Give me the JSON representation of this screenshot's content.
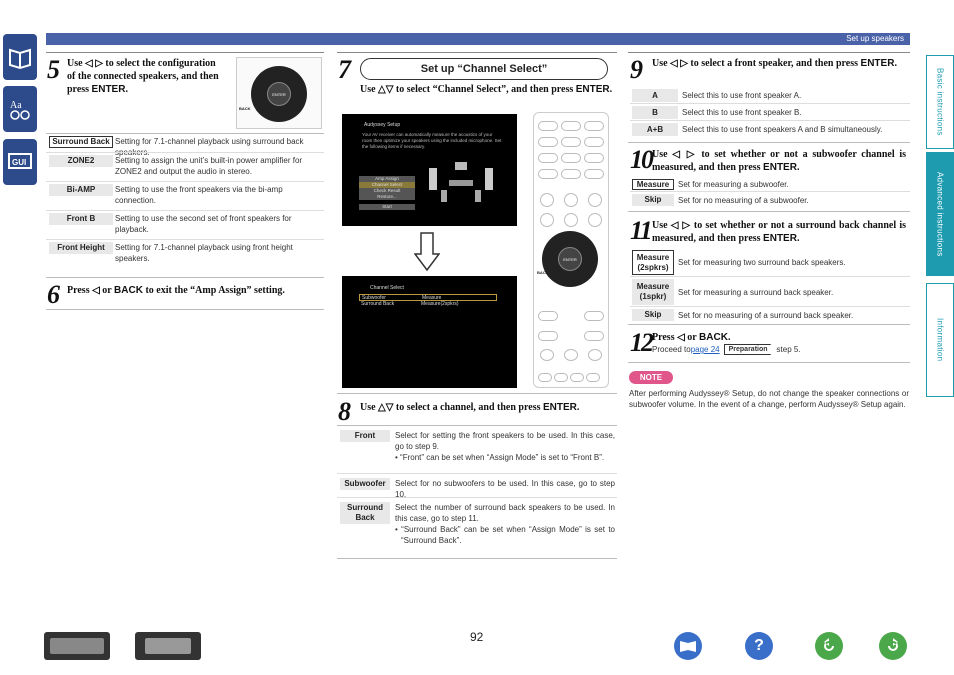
{
  "header": {
    "section": "Set up speakers"
  },
  "sidebar_tabs": [
    "Basic instructions",
    "Advanced instructions",
    "Information"
  ],
  "step5": {
    "num": "5",
    "text_pre": "Use ◁ ▷ to select the configuration of the connected speakers, and then press ",
    "enter": "ENTER",
    "text_post": ".",
    "rows": [
      {
        "label": "Surround Back",
        "desc": "Setting for 7.1-channel playback using surround back speakers."
      },
      {
        "label": "ZONE2",
        "desc": "Setting to assign the unit’s built-in power amplifier for ZONE2 and output the audio in stereo."
      },
      {
        "label": "Bi-AMP",
        "desc": "Setting to use the front speakers via the bi-amp connection."
      },
      {
        "label": "Front B",
        "desc": "Setting to use the second set of front speakers for playback."
      },
      {
        "label": "Front Height",
        "desc": "Setting for 7.1-channel playback using front height speakers."
      }
    ]
  },
  "step6": {
    "num": "6",
    "text_pre": "Press ◁ or ",
    "back": "BACK",
    "text_post": " to exit the “Amp Assign” setting."
  },
  "step7": {
    "num": "7",
    "title": "Set up “Channel Select”",
    "text_pre": "Use △▽ to select “Channel Select”, and then press ",
    "enter": "ENTER",
    "text_post": "."
  },
  "screen1": {
    "title": "Audyssey Setup",
    "body": "Your AV receiver can automatically measure the acoustics of your room then optimize your speakers using the included microphone. Set the following items if necessary.",
    "menu": [
      "Amp Assign",
      "Channel Select",
      "Check Result",
      "Restore...",
      "Start"
    ]
  },
  "screen2": {
    "title": "Channel Select",
    "rows": [
      [
        "Subwoofer",
        "Measure"
      ],
      [
        "Surround Back",
        "Measure(2spkrs)"
      ]
    ]
  },
  "step8": {
    "num": "8",
    "text_pre": "Use △▽ to select a channel, and then press ",
    "enter": "ENTER",
    "text_post": ".",
    "rows": [
      {
        "label": "Front",
        "lines": [
          "Select for setting the front speakers to be used. In this case, go to step 9.",
          "• “Front” can be set when “Assign Mode” is set to “Front B”."
        ]
      },
      {
        "label": "Subwoofer",
        "lines": [
          "Select for no subwoofers to be used. In this case, go to step 10."
        ]
      },
      {
        "label": "Surround Back",
        "lines": [
          "Select the number of surround back speakers to be used. In this case, go to step 11.",
          "• “Surround Back” can be set when “Assign Mode” is set to “Surround Back”."
        ]
      }
    ]
  },
  "step9": {
    "num": "9",
    "text_pre": "Use ◁ ▷ to select a front speaker, and then press ",
    "enter": "ENTER",
    "text_post": ".",
    "rows": [
      {
        "label": "A",
        "desc": "Select this to use front speaker A."
      },
      {
        "label": "B",
        "desc": "Select this to use front speaker B."
      },
      {
        "label": "A+B",
        "desc": "Select this to use front speakers A and B simultaneously."
      }
    ]
  },
  "step10": {
    "num": "10",
    "text_pre": "Use ◁ ▷ to set whether or not a subwoofer channel is measured, and then press ",
    "enter": "ENTER",
    "text_post": ".",
    "rows": [
      {
        "label": "Measure",
        "desc": "Set for measuring a subwoofer."
      },
      {
        "label": "Skip",
        "desc": "Set for no measuring of a subwoofer."
      }
    ]
  },
  "step11": {
    "num": "11",
    "text_pre": "Use ◁ ▷ to set whether or not a surround back channel is measured, and then press ",
    "enter": "ENTER",
    "text_post": ".",
    "rows": [
      {
        "label": "Measure (2spkrs)",
        "desc": "Set for measuring two surround back speakers."
      },
      {
        "label": "Measure (1spkr)",
        "desc": "Set for measuring a surround back speaker."
      },
      {
        "label": "Skip",
        "desc": "Set for no measuring of a surround back speaker."
      }
    ]
  },
  "step12": {
    "num": "12",
    "text_pre": "Press ◁ or ",
    "back": "BACK",
    "text_post": ".",
    "proceed": "Proceed to ",
    "link": "page 24",
    "badge": "Preparation",
    "tail": " step 5."
  },
  "note": {
    "label": "NOTE",
    "text": "After performing Audyssey® Setup, do not change the speaker connections or subwoofer volume. In the event of a change, perform Audyssey® Setup again."
  },
  "remote": {
    "enter": "ENTER",
    "back": "BACK"
  },
  "page_number": "92"
}
